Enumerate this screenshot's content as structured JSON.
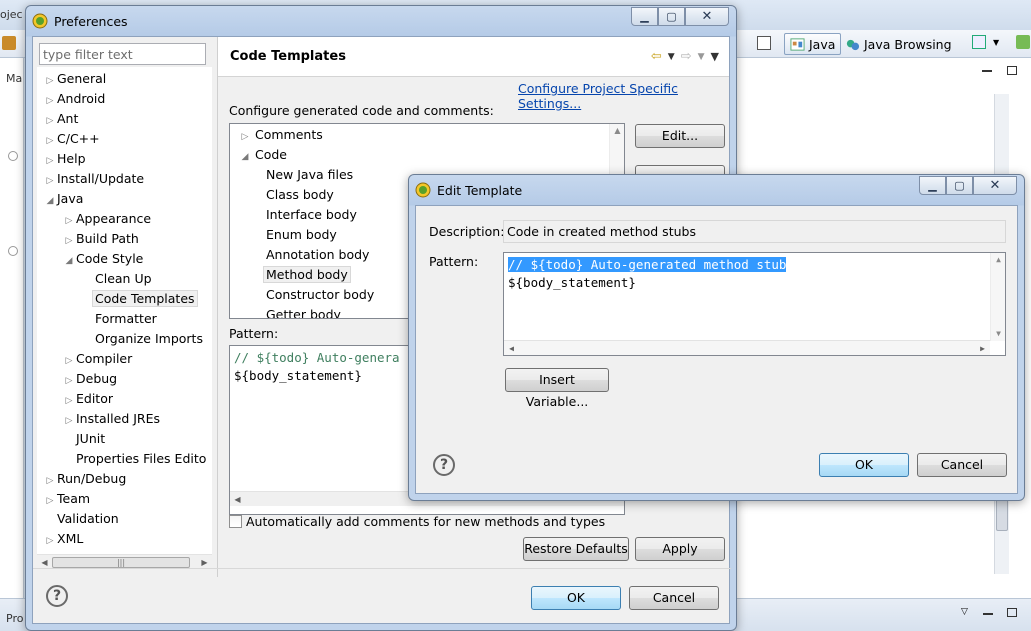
{
  "workbench": {
    "tab_fragment": "ojec",
    "left_fragment": "Ma",
    "bottom_fragment": "Pro",
    "perspectives": [
      {
        "label": "Java",
        "active": true
      },
      {
        "label": "Java Browsing",
        "active": false
      }
    ]
  },
  "preferences": {
    "title": "Preferences",
    "filter_placeholder": "type filter text",
    "tree": [
      {
        "label": "General",
        "level": 0,
        "twisty": "collapsed"
      },
      {
        "label": "Android",
        "level": 0,
        "twisty": "collapsed"
      },
      {
        "label": "Ant",
        "level": 0,
        "twisty": "collapsed"
      },
      {
        "label": "C/C++",
        "level": 0,
        "twisty": "collapsed"
      },
      {
        "label": "Help",
        "level": 0,
        "twisty": "collapsed"
      },
      {
        "label": "Install/Update",
        "level": 0,
        "twisty": "collapsed"
      },
      {
        "label": "Java",
        "level": 0,
        "twisty": "expanded"
      },
      {
        "label": "Appearance",
        "level": 1,
        "twisty": "collapsed"
      },
      {
        "label": "Build Path",
        "level": 1,
        "twisty": "collapsed"
      },
      {
        "label": "Code Style",
        "level": 1,
        "twisty": "expanded"
      },
      {
        "label": "Clean Up",
        "level": 2,
        "twisty": "none"
      },
      {
        "label": "Code Templates",
        "level": 2,
        "twisty": "none",
        "selected": true
      },
      {
        "label": "Formatter",
        "level": 2,
        "twisty": "none"
      },
      {
        "label": "Organize Imports",
        "level": 2,
        "twisty": "none"
      },
      {
        "label": "Compiler",
        "level": 1,
        "twisty": "collapsed"
      },
      {
        "label": "Debug",
        "level": 1,
        "twisty": "collapsed"
      },
      {
        "label": "Editor",
        "level": 1,
        "twisty": "collapsed"
      },
      {
        "label": "Installed JREs",
        "level": 1,
        "twisty": "collapsed"
      },
      {
        "label": "JUnit",
        "level": 1,
        "twisty": "none"
      },
      {
        "label": "Properties Files Edito",
        "level": 1,
        "twisty": "none"
      },
      {
        "label": "Run/Debug",
        "level": 0,
        "twisty": "collapsed"
      },
      {
        "label": "Team",
        "level": 0,
        "twisty": "collapsed"
      },
      {
        "label": "Validation",
        "level": 0,
        "twisty": "none"
      },
      {
        "label": "XML",
        "level": 0,
        "twisty": "collapsed"
      }
    ],
    "page_title": "Code Templates",
    "project_link": "Configure Project Specific Settings...",
    "configure_label": "Configure generated code and comments:",
    "templates": [
      {
        "label": "Comments",
        "level": 0,
        "twisty": "collapsed"
      },
      {
        "label": "Code",
        "level": 0,
        "twisty": "expanded"
      },
      {
        "label": "New Java files",
        "level": 1
      },
      {
        "label": "Class body",
        "level": 1
      },
      {
        "label": "Interface body",
        "level": 1
      },
      {
        "label": "Enum body",
        "level": 1
      },
      {
        "label": "Annotation body",
        "level": 1
      },
      {
        "label": "Method body",
        "level": 1,
        "selected": true
      },
      {
        "label": "Constructor body",
        "level": 1
      },
      {
        "label": "Getter body",
        "level": 1
      }
    ],
    "edit_button": "Edit...",
    "pattern_label": "Pattern:",
    "pattern_line1": "// ${todo} Auto-genera",
    "pattern_line2": "${body_statement}",
    "auto_comments_label": "Automatically add comments for new methods and types",
    "restore_defaults": "Restore Defaults",
    "apply": "Apply",
    "ok": "OK",
    "cancel": "Cancel"
  },
  "edit_template": {
    "title": "Edit Template",
    "description_label": "Description:",
    "description_value": "Code in created method stubs",
    "pattern_label": "Pattern:",
    "pattern_line1": "// ${todo} Auto-generated method stub",
    "pattern_line2": "${body_statement}",
    "insert_variable": "Insert Variable...",
    "ok": "OK",
    "cancel": "Cancel"
  }
}
